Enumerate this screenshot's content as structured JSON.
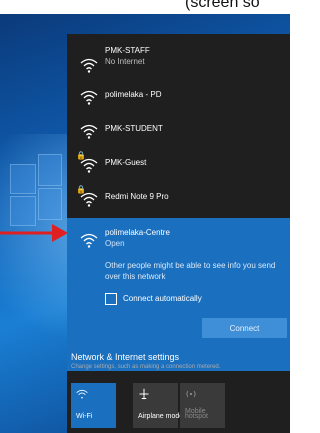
{
  "top_text": "(screen so",
  "networks": [
    {
      "name": "PMK-STAFF",
      "status": "No Internet",
      "secured": false
    },
    {
      "name": "polimelaka - PD",
      "status": "",
      "secured": false
    },
    {
      "name": "PMK-STUDENT",
      "status": "",
      "secured": false
    },
    {
      "name": "PMK-Guest",
      "status": "",
      "secured": true
    },
    {
      "name": "Redmi Note 9 Pro",
      "status": "",
      "secured": true
    }
  ],
  "selected_network": {
    "name": "polimelaka-Centre",
    "status": "Open",
    "warning": "Other people might be able to see info you send over this network",
    "auto_connect_label": "Connect automatically",
    "auto_connect_checked": false,
    "connect_label": "Connect"
  },
  "settings": {
    "link": "Network & Internet settings",
    "subtitle": "Change settings, such as making a connection metered."
  },
  "tiles": {
    "wifi": "Wi-Fi",
    "airplane": "Airplane mode",
    "hotspot_line1": "Mobile",
    "hotspot_line2": "hotspot"
  },
  "colors": {
    "selected_bg": "#1a6fbf",
    "flyout_bg": "#1f1f1f",
    "arrow": "#e02020",
    "wifi_tile": "#1a6fbf"
  },
  "icons": [
    "wifi-icon",
    "lock-icon",
    "airplane-icon",
    "hotspot-icon",
    "red-arrow-icon"
  ]
}
